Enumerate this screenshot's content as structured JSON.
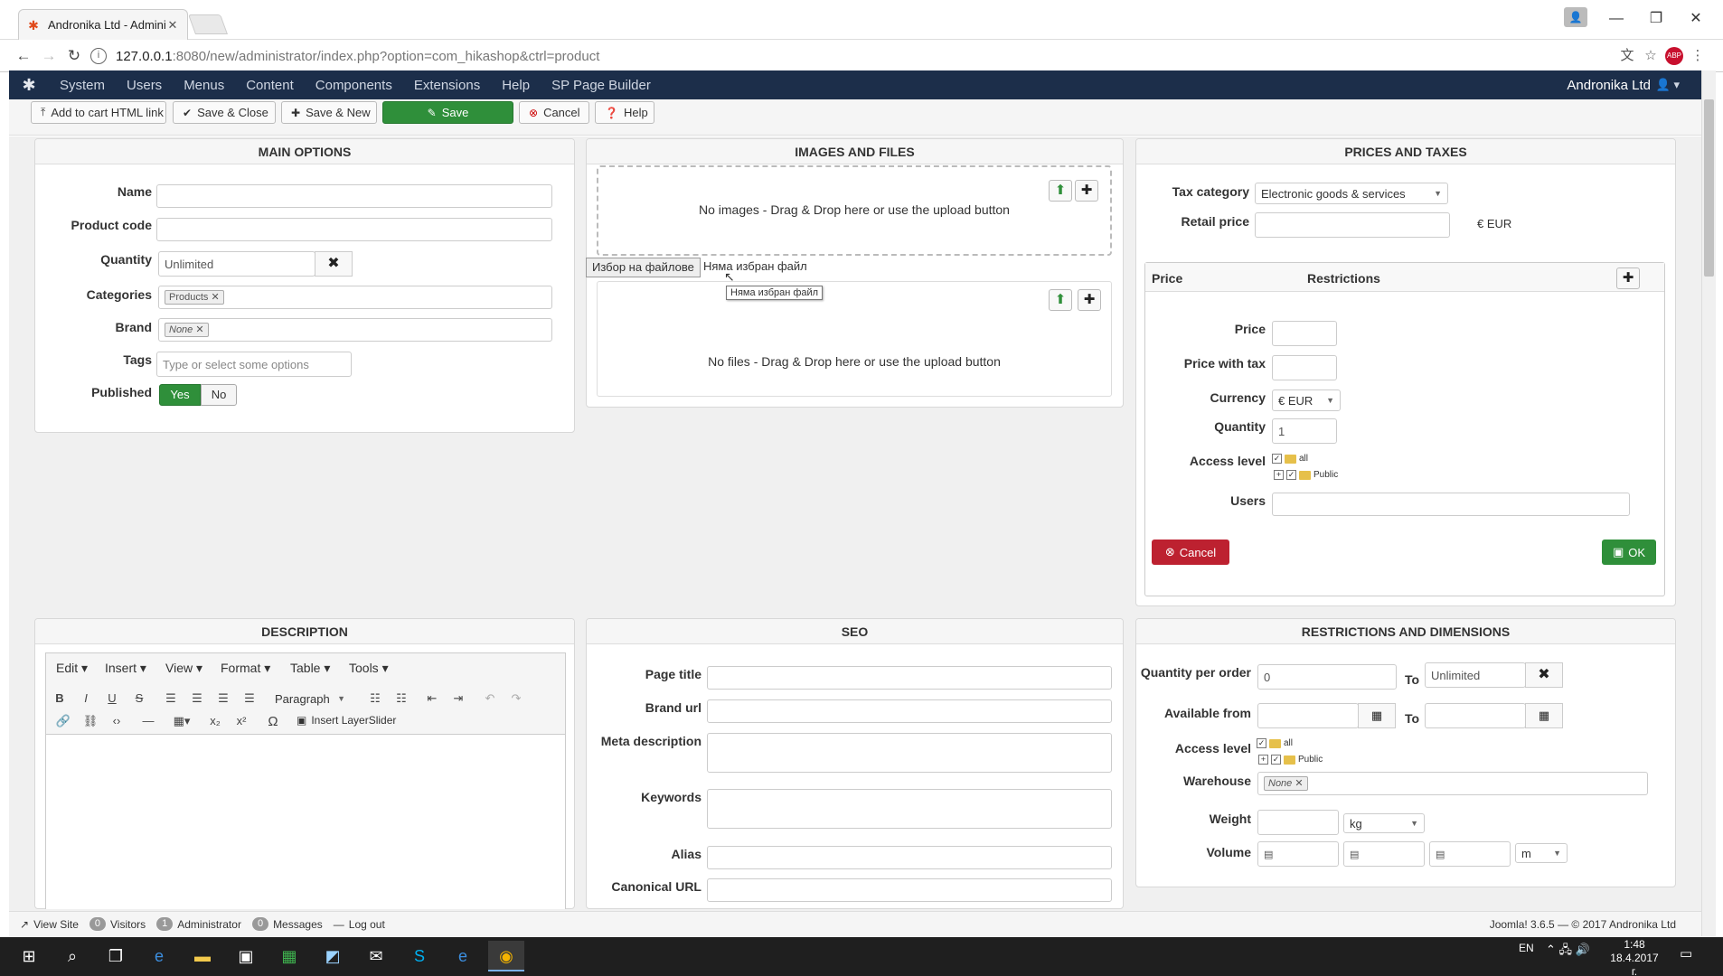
{
  "browser": {
    "tab_title": "Andronika Ltd - Adminis",
    "url_host": "127.0.0.1",
    "url_rest": ":8080/new/administrator/index.php?option=com_hikashop&ctrl=product",
    "icons": {
      "favicon": "joomla-icon",
      "back": "back-arrow-icon",
      "forward": "forward-arrow-icon",
      "reload": "reload-icon"
    }
  },
  "nav": {
    "items": [
      "System",
      "Users",
      "Menus",
      "Content",
      "Components",
      "Extensions",
      "Help",
      "SP Page Builder"
    ],
    "site": "Andronika Ltd"
  },
  "toolbar": {
    "add_cart": "Add to cart HTML link",
    "save_close": "Save & Close",
    "save_new": "Save & New",
    "save": "Save",
    "cancel": "Cancel",
    "help": "Help"
  },
  "main_options": {
    "title": "MAIN OPTIONS",
    "name_label": "Name",
    "code_label": "Product code",
    "qty_label": "Quantity",
    "qty_value": "Unlimited",
    "cat_label": "Categories",
    "cat_chip": "Products",
    "brand_label": "Brand",
    "brand_chip": "None",
    "tags_label": "Tags",
    "tags_placeholder": "Type or select some options",
    "published_label": "Published",
    "yes": "Yes",
    "no": "No"
  },
  "images": {
    "title": "IMAGES AND FILES",
    "no_images": "No images - Drag & Drop here or use the upload button",
    "file_button": "Избор на файлове",
    "no_file": "Няма избран файл",
    "tooltip": "Няма избран файл",
    "no_files": "No files - Drag & Drop here or use the upload button"
  },
  "prices": {
    "title": "PRICES AND TAXES",
    "tax_label": "Tax category",
    "tax_value": "Electronic goods & services",
    "retail_label": "Retail price",
    "retail_unit": "€ EUR",
    "col_price": "Price",
    "col_restrictions": "Restrictions",
    "price_label": "Price",
    "price_tax_label": "Price with tax",
    "currency_label": "Currency",
    "currency_value": "€ EUR",
    "quantity_label": "Quantity",
    "quantity_value": "1",
    "access_label": "Access level",
    "access_all": "all",
    "access_public": "Public",
    "users_label": "Users",
    "cancel": "Cancel",
    "ok": "OK"
  },
  "description": {
    "title": "DESCRIPTION",
    "menus": [
      "Edit",
      "Insert",
      "View",
      "Format",
      "Table",
      "Tools"
    ],
    "paragraph": "Paragraph",
    "layerslider": "Insert LayerSlider"
  },
  "seo": {
    "title": "SEO",
    "page_title": "Page title",
    "brand_url": "Brand url",
    "meta": "Meta description",
    "keywords": "Keywords",
    "alias": "Alias",
    "canonical": "Canonical URL"
  },
  "restrictions": {
    "title": "RESTRICTIONS AND DIMENSIONS",
    "qpo_label": "Quantity per order",
    "qpo_from": "0",
    "to": "To",
    "qpo_to": "Unlimited",
    "avail_label": "Available from",
    "access_label": "Access level",
    "access_all": "all",
    "access_public": "Public",
    "warehouse_label": "Warehouse",
    "warehouse_chip": "None",
    "weight_label": "Weight",
    "weight_unit": "kg",
    "volume_label": "Volume",
    "volume_unit": "m"
  },
  "status": {
    "view_site": "View Site",
    "visitors_count": "0",
    "visitors": "Visitors",
    "admin_count": "1",
    "admin": "Administrator",
    "messages_count": "0",
    "messages": "Messages",
    "logout": "Log out",
    "copyright": "Joomla! 3.6.5 — © 2017 Andronika Ltd"
  },
  "taskbar": {
    "lang": "EN",
    "time": "1:48",
    "date": "18.4.2017 г."
  }
}
